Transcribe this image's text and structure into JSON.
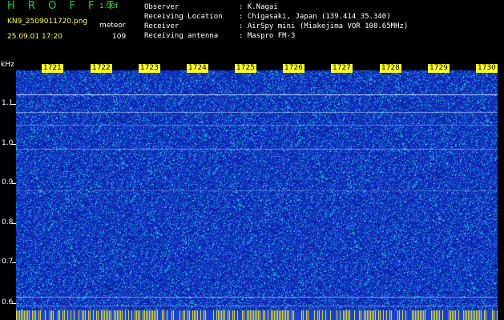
{
  "header": {
    "app_title": "H R O F F T",
    "version": "1.00f",
    "filename": "KN9_2509011720.png",
    "mode": "meteor",
    "datetime": "25.09.01 17:20",
    "count": "109",
    "info": [
      {
        "label": "Observer",
        "value": ": K.Nagai"
      },
      {
        "label": "Receiving Location",
        "value": ": Chigasaki, Japan (139.414 35.340)"
      },
      {
        "label": "Receiver",
        "value": ": AirSpy mini (Miakejima VOR 108.65MHz)"
      },
      {
        "label": "Receiving antenna",
        "value": ": Maspro FM-3"
      }
    ]
  },
  "spectrogram": {
    "unit": "kHz",
    "y_ticks": [
      "1.1",
      "1.0",
      "0.9",
      "0.8",
      "0.7",
      "0.6"
    ],
    "time_ticks": [
      "1721",
      "1722",
      "1723",
      "1724",
      "1725",
      "1726",
      "1727",
      "1728",
      "1729",
      "1730"
    ],
    "colors": {
      "background": "#1233c8",
      "noise": "#1ec8e6",
      "tick_bg": "#ffff2a",
      "strip": "#ffff2a"
    }
  }
}
